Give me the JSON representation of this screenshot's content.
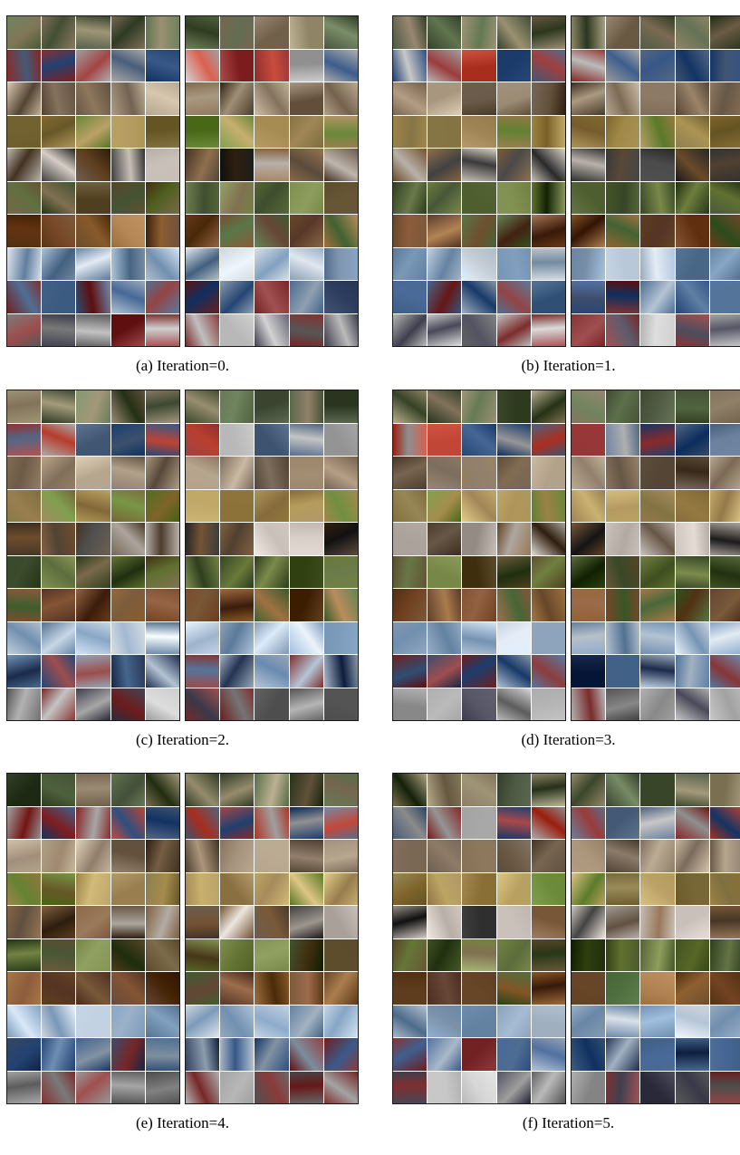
{
  "figure": {
    "panels": [
      {
        "id": "a",
        "caption": "(a) Iteration=0."
      },
      {
        "id": "b",
        "caption": "(b) Iteration=1."
      },
      {
        "id": "c",
        "caption": "(c) Iteration=2."
      },
      {
        "id": "d",
        "caption": "(d) Iteration=3."
      },
      {
        "id": "e",
        "caption": "(e) Iteration=4."
      },
      {
        "id": "f",
        "caption": "(f) Iteration=5."
      }
    ]
  },
  "colors": {
    "row_palettes": [
      [
        "#6b7f5a",
        "#8a7a63",
        "#4e5a3e",
        "#a59b7c",
        "#3f4b34"
      ],
      [
        "#2f4f7f",
        "#9a3a3a",
        "#b8b8b8",
        "#5a6f8c",
        "#c54a3a"
      ],
      [
        "#7a6a5a",
        "#a08a70",
        "#5a4a3a",
        "#c8b8a0",
        "#8c7a66"
      ],
      [
        "#8a7a4a",
        "#a68c52",
        "#6b8a3a",
        "#c8b070",
        "#9a8050"
      ],
      [
        "#5a4a3a",
        "#d8d0c8",
        "#8a6a4a",
        "#3a3a3a",
        "#c0b8b0"
      ],
      [
        "#5a6a3a",
        "#7a8a4a",
        "#3a4a2a",
        "#8a9a5a",
        "#6a5a3a"
      ],
      [
        "#6a4a2a",
        "#8a5a3a",
        "#4a6a3a",
        "#a87a4a",
        "#5a3a2a"
      ],
      [
        "#8aa8c8",
        "#c8d8e8",
        "#6a88a8",
        "#e0e8f0",
        "#9ab0c8"
      ],
      [
        "#3a5a8a",
        "#5a7aa0",
        "#8a3a3a",
        "#2a3a5a",
        "#a8b8c8"
      ],
      [
        "#6a6a6a",
        "#8a3a3a",
        "#b0b0b0",
        "#4a4a5a",
        "#c8c8c8"
      ]
    ]
  }
}
